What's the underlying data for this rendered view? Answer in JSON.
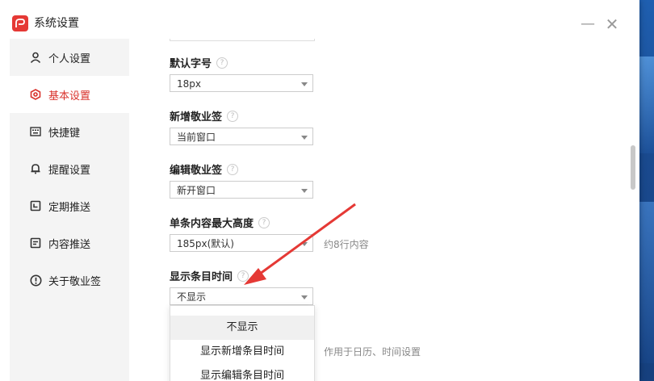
{
  "window": {
    "title": "系统设置",
    "minimize": "—",
    "close": "✕"
  },
  "sidebar": {
    "items": [
      {
        "label": "个人设置",
        "icon": "person-icon"
      },
      {
        "label": "基本设置",
        "icon": "settings-icon",
        "active": true
      },
      {
        "label": "快捷键",
        "icon": "keyboard-icon"
      },
      {
        "label": "提醒设置",
        "icon": "bell-icon"
      },
      {
        "label": "定期推送",
        "icon": "calendar-icon"
      },
      {
        "label": "内容推送",
        "icon": "document-icon"
      },
      {
        "label": "关于敬业签",
        "icon": "info-icon"
      }
    ]
  },
  "settings": {
    "font_size": {
      "label": "默认字号",
      "value": "18px"
    },
    "new_note": {
      "label": "新增敬业签",
      "value": "当前窗口"
    },
    "edit_note": {
      "label": "编辑敬业签",
      "value": "新开窗口"
    },
    "max_height": {
      "label": "单条内容最大高度",
      "value": "185px(默认)",
      "hint": "约8行内容"
    },
    "show_time": {
      "label": "显示条目时间",
      "value": "不显示",
      "hint": "作用于日历、时间设置"
    }
  },
  "dropdown": {
    "options": [
      "不显示",
      "显示新增条目时间",
      "显示编辑条目时间"
    ],
    "selected_index": 0
  },
  "help_glyph": "?",
  "colors": {
    "accent": "#d9332c",
    "sidebar_bg": "#f4f4f4",
    "logo": "#e53935"
  }
}
